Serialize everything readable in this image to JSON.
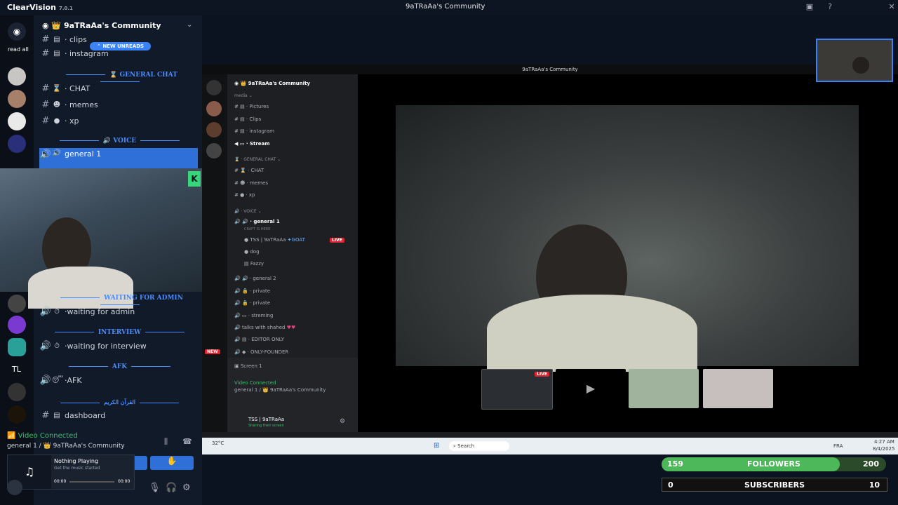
{
  "app": {
    "name": "ClearVision",
    "version": "7.0.1",
    "window_title": "9aTRaAa's Community"
  },
  "rail": {
    "read_all": "read all",
    "tl": "TL"
  },
  "sidebar": {
    "server": "9aTRaAa's Community",
    "new_unreads": "NEW UNREADS",
    "channels_top": [
      {
        "emoji": "▤",
        "name": "· clips"
      },
      {
        "emoji": "▤",
        "name": "· instagram"
      }
    ],
    "cat_general": "GENERAL CHAT",
    "general": [
      {
        "emoji": "⌛",
        "name": "· CHAT"
      },
      {
        "emoji": "☻",
        "name": "· memes"
      },
      {
        "emoji": "●",
        "name": "· xp"
      }
    ],
    "cat_voice": "VOICE",
    "voice_selected": "general 1",
    "cat_waiting": "WAITING FOR ADMIN",
    "waiting": "waiting for admin",
    "cat_interview": "INTERVIEW",
    "interview": "waiting for interview",
    "cat_afk": "AFK",
    "afk": "AFK",
    "cat_quran": "القرآن الكريم",
    "dashboard": "dashboard",
    "video_connected": "Video Connected",
    "video_sub": "general 1 / 👑 9aTRaAa's Community",
    "music_title": "Nothing Playing",
    "music_sub": "Get the music started",
    "music_t0": "00:00",
    "music_t1": "00:00",
    "k_badge": "8"
  },
  "inner": {
    "title": "9aTRaAa's Community",
    "server": "9aTRaAa's Community",
    "cat_media": "media",
    "media": [
      "Pictures",
      "Clips",
      "instagram",
      "Stream"
    ],
    "cat_general": "GENERAL CHAT",
    "general": [
      "CHAT",
      "memes",
      "xp"
    ],
    "cat_voice": "VOICE",
    "voice": "general 1",
    "voice_sub": "CRAFT IS HERE",
    "members": [
      "TSS | 9aTRaAa",
      "dog",
      "Fazzy"
    ],
    "goat": "GOAT",
    "live": "LIVE",
    "more": [
      "general 2",
      "private",
      "private",
      "streming",
      "talks with shahed",
      "EDITOR ONLY",
      "ONLY-FOUNDER"
    ],
    "screen": "Screen 1",
    "video_connected": "Video Connected",
    "video_sub": "general 1 / 👑 9aTRaAa's Community",
    "user": "TSS | 9aTRaAa",
    "user_status": "Sharing their screen",
    "new": "NEW",
    "weather": "32°C",
    "search": "Search",
    "lang": "FRA",
    "clock": "4:27 AM",
    "date": "8/4/2025"
  },
  "counters": {
    "followers_label": "FOLLOWERS",
    "followers_value": "159",
    "followers_goal": "200",
    "followers_fraction": 0.795,
    "subs_label": "SUBSCRIBERS",
    "subs_value": "0",
    "subs_goal": "10"
  },
  "colors": {
    "accent": "#3b82f6",
    "green": "#3fbf6f",
    "followers_bar": "#4cb85a",
    "live": "#e0242f"
  }
}
